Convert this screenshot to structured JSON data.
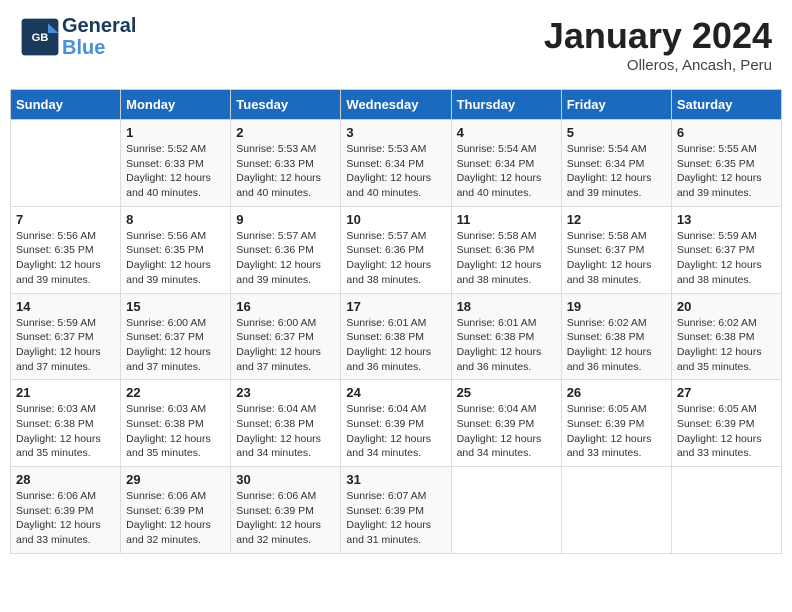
{
  "logo": {
    "line1": "General",
    "line2": "Blue"
  },
  "title": "January 2024",
  "subtitle": "Olleros, Ancash, Peru",
  "days_header": [
    "Sunday",
    "Monday",
    "Tuesday",
    "Wednesday",
    "Thursday",
    "Friday",
    "Saturday"
  ],
  "weeks": [
    [
      {
        "num": "",
        "info": ""
      },
      {
        "num": "1",
        "info": "Sunrise: 5:52 AM\nSunset: 6:33 PM\nDaylight: 12 hours\nand 40 minutes."
      },
      {
        "num": "2",
        "info": "Sunrise: 5:53 AM\nSunset: 6:33 PM\nDaylight: 12 hours\nand 40 minutes."
      },
      {
        "num": "3",
        "info": "Sunrise: 5:53 AM\nSunset: 6:34 PM\nDaylight: 12 hours\nand 40 minutes."
      },
      {
        "num": "4",
        "info": "Sunrise: 5:54 AM\nSunset: 6:34 PM\nDaylight: 12 hours\nand 40 minutes."
      },
      {
        "num": "5",
        "info": "Sunrise: 5:54 AM\nSunset: 6:34 PM\nDaylight: 12 hours\nand 39 minutes."
      },
      {
        "num": "6",
        "info": "Sunrise: 5:55 AM\nSunset: 6:35 PM\nDaylight: 12 hours\nand 39 minutes."
      }
    ],
    [
      {
        "num": "7",
        "info": "Sunrise: 5:56 AM\nSunset: 6:35 PM\nDaylight: 12 hours\nand 39 minutes."
      },
      {
        "num": "8",
        "info": "Sunrise: 5:56 AM\nSunset: 6:35 PM\nDaylight: 12 hours\nand 39 minutes."
      },
      {
        "num": "9",
        "info": "Sunrise: 5:57 AM\nSunset: 6:36 PM\nDaylight: 12 hours\nand 39 minutes."
      },
      {
        "num": "10",
        "info": "Sunrise: 5:57 AM\nSunset: 6:36 PM\nDaylight: 12 hours\nand 38 minutes."
      },
      {
        "num": "11",
        "info": "Sunrise: 5:58 AM\nSunset: 6:36 PM\nDaylight: 12 hours\nand 38 minutes."
      },
      {
        "num": "12",
        "info": "Sunrise: 5:58 AM\nSunset: 6:37 PM\nDaylight: 12 hours\nand 38 minutes."
      },
      {
        "num": "13",
        "info": "Sunrise: 5:59 AM\nSunset: 6:37 PM\nDaylight: 12 hours\nand 38 minutes."
      }
    ],
    [
      {
        "num": "14",
        "info": "Sunrise: 5:59 AM\nSunset: 6:37 PM\nDaylight: 12 hours\nand 37 minutes."
      },
      {
        "num": "15",
        "info": "Sunrise: 6:00 AM\nSunset: 6:37 PM\nDaylight: 12 hours\nand 37 minutes."
      },
      {
        "num": "16",
        "info": "Sunrise: 6:00 AM\nSunset: 6:37 PM\nDaylight: 12 hours\nand 37 minutes."
      },
      {
        "num": "17",
        "info": "Sunrise: 6:01 AM\nSunset: 6:38 PM\nDaylight: 12 hours\nand 36 minutes."
      },
      {
        "num": "18",
        "info": "Sunrise: 6:01 AM\nSunset: 6:38 PM\nDaylight: 12 hours\nand 36 minutes."
      },
      {
        "num": "19",
        "info": "Sunrise: 6:02 AM\nSunset: 6:38 PM\nDaylight: 12 hours\nand 36 minutes."
      },
      {
        "num": "20",
        "info": "Sunrise: 6:02 AM\nSunset: 6:38 PM\nDaylight: 12 hours\nand 35 minutes."
      }
    ],
    [
      {
        "num": "21",
        "info": "Sunrise: 6:03 AM\nSunset: 6:38 PM\nDaylight: 12 hours\nand 35 minutes."
      },
      {
        "num": "22",
        "info": "Sunrise: 6:03 AM\nSunset: 6:38 PM\nDaylight: 12 hours\nand 35 minutes."
      },
      {
        "num": "23",
        "info": "Sunrise: 6:04 AM\nSunset: 6:38 PM\nDaylight: 12 hours\nand 34 minutes."
      },
      {
        "num": "24",
        "info": "Sunrise: 6:04 AM\nSunset: 6:39 PM\nDaylight: 12 hours\nand 34 minutes."
      },
      {
        "num": "25",
        "info": "Sunrise: 6:04 AM\nSunset: 6:39 PM\nDaylight: 12 hours\nand 34 minutes."
      },
      {
        "num": "26",
        "info": "Sunrise: 6:05 AM\nSunset: 6:39 PM\nDaylight: 12 hours\nand 33 minutes."
      },
      {
        "num": "27",
        "info": "Sunrise: 6:05 AM\nSunset: 6:39 PM\nDaylight: 12 hours\nand 33 minutes."
      }
    ],
    [
      {
        "num": "28",
        "info": "Sunrise: 6:06 AM\nSunset: 6:39 PM\nDaylight: 12 hours\nand 33 minutes."
      },
      {
        "num": "29",
        "info": "Sunrise: 6:06 AM\nSunset: 6:39 PM\nDaylight: 12 hours\nand 32 minutes."
      },
      {
        "num": "30",
        "info": "Sunrise: 6:06 AM\nSunset: 6:39 PM\nDaylight: 12 hours\nand 32 minutes."
      },
      {
        "num": "31",
        "info": "Sunrise: 6:07 AM\nSunset: 6:39 PM\nDaylight: 12 hours\nand 31 minutes."
      },
      {
        "num": "",
        "info": ""
      },
      {
        "num": "",
        "info": ""
      },
      {
        "num": "",
        "info": ""
      }
    ]
  ]
}
